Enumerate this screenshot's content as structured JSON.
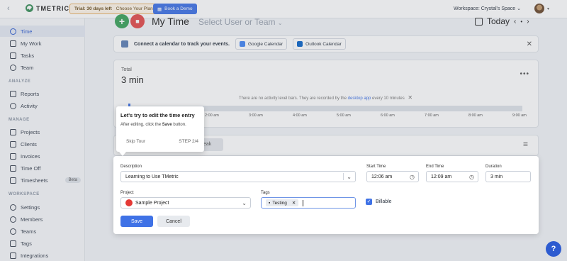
{
  "topbar": {
    "logo_text": "TMETRIC",
    "trial_days": "Trial: 30 days left",
    "trial_link": "Choose Your Plan",
    "demo_label": "Book a Demo",
    "workspace": "Workspace: Crystal's Space"
  },
  "sidebar": {
    "items_main": [
      {
        "label": "Time",
        "icon": "clock-icon"
      },
      {
        "label": "My Work",
        "icon": "briefcase-icon"
      },
      {
        "label": "Tasks",
        "icon": "tasks-icon"
      },
      {
        "label": "Team",
        "icon": "team-icon"
      }
    ],
    "section_analyze": "ANALYZE",
    "items_analyze": [
      {
        "label": "Reports",
        "icon": "reports-icon"
      },
      {
        "label": "Activity",
        "icon": "activity-icon"
      }
    ],
    "section_manage": "MANAGE",
    "items_manage": [
      {
        "label": "Projects",
        "icon": "projects-icon"
      },
      {
        "label": "Clients",
        "icon": "clients-icon"
      },
      {
        "label": "Invoices",
        "icon": "invoices-icon"
      },
      {
        "label": "Time Off",
        "icon": "time-off-icon"
      },
      {
        "label": "Timesheets",
        "icon": "timesheets-icon",
        "badge": "Beta"
      }
    ],
    "section_workspace": "WORKSPACE",
    "items_workspace": [
      {
        "label": "Settings",
        "icon": "gear-icon"
      },
      {
        "label": "Members",
        "icon": "members-icon"
      },
      {
        "label": "Teams",
        "icon": "teams-icon"
      },
      {
        "label": "Tags",
        "icon": "tag-icon"
      },
      {
        "label": "Integrations",
        "icon": "integrations-icon"
      }
    ]
  },
  "header": {
    "title": "My Time",
    "user_select": "Select User or Team",
    "date_label": "Today"
  },
  "calendar_banner": {
    "text": "Connect a calendar to track your events.",
    "google": "Google Calendar",
    "outlook": "Outlook Calendar"
  },
  "summary": {
    "total_label": "Total",
    "total_value": "3 min",
    "activity_note": "There are no activity level bars. They are recorded by the",
    "activity_link": "desktop app",
    "activity_note_end": "every 10 minutes",
    "ticks": [
      "2:00 am",
      "3:00 am",
      "4:00 am",
      "5:00 am",
      "6:00 am",
      "7:00 am",
      "8:00 am",
      "9:00 am"
    ]
  },
  "entries": {
    "break_label": "eak"
  },
  "editor": {
    "description_label": "Description",
    "description_value": "Learning to Use TMetric",
    "start_label": "Start Time",
    "start_value": "12:06 am",
    "end_label": "End Time",
    "end_value": "12:09 am",
    "duration_label": "Duration",
    "duration_value": "3 min",
    "project_label": "Project",
    "project_value": "Sample Project",
    "project_color": "#e53935",
    "tags_label": "Tags",
    "tag_value": "Testing",
    "billable_label": "Billable",
    "billable_checked": true,
    "save_label": "Save",
    "cancel_label": "Cancel"
  },
  "tour": {
    "title": "Let's try to edit the time entry",
    "body_pre": "After editing, click the",
    "body_bold": "Save",
    "body_post": "button.",
    "skip": "Skip Tour",
    "step": "STEP 2/4"
  },
  "colors": {
    "accent": "#3f72e6",
    "start_green": "#3ba35b",
    "stop_red": "#e34b4b"
  }
}
